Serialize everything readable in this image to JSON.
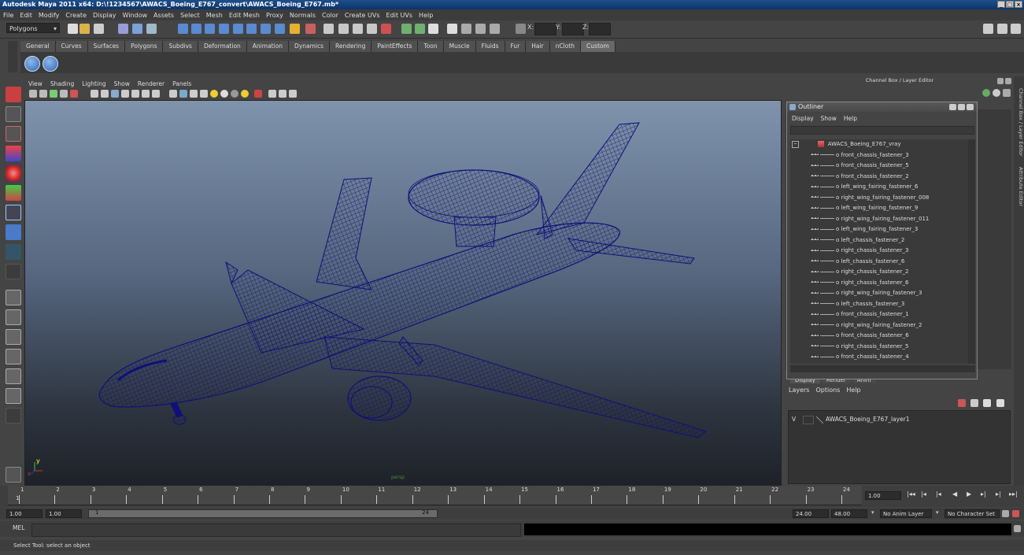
{
  "window": {
    "title": "Autodesk Maya 2011 x64: D:\\!1234567\\AWACS_Boeing_E767_convert\\AWACS_Boeing_E767.mb*",
    "controls": [
      "_",
      "□",
      "×"
    ]
  },
  "menubar": [
    "File",
    "Edit",
    "Modify",
    "Create",
    "Display",
    "Window",
    "Assets",
    "Select",
    "Mesh",
    "Edit Mesh",
    "Proxy",
    "Normals",
    "Color",
    "Create UVs",
    "Edit UVs",
    "Help"
  ],
  "statusline": {
    "mode": "Polygons",
    "x_label": "X:",
    "y_label": "Y:",
    "z_label": "Z:"
  },
  "shelf_tabs": [
    "General",
    "Curves",
    "Surfaces",
    "Polygons",
    "Subdivs",
    "Deformation",
    "Animation",
    "Dynamics",
    "Rendering",
    "PaintEffects",
    "Toon",
    "Muscle",
    "Fluids",
    "Fur",
    "Hair",
    "nCloth",
    "Custom"
  ],
  "shelf_active_tab": "Custom",
  "panel_menu": [
    "View",
    "Shading",
    "Lighting",
    "Show",
    "Renderer",
    "Panels"
  ],
  "viewport": {
    "camera_label": "persp",
    "wire_color": "#10107a",
    "axis_y": "y",
    "axis_x": "x"
  },
  "channel_box": {
    "title": "Channel Box / Layer Editor"
  },
  "side_tabs": [
    "Channel Box / Layer Editor",
    "Attribute Editor"
  ],
  "outliner": {
    "title": "Outliner",
    "menu": [
      "Display",
      "Show",
      "Help"
    ],
    "root": "AWACS_Boeing_E767_vray",
    "items": [
      "front_chassis_fastener_3",
      "front_chassis_fastener_5",
      "front_chassis_fastener_2",
      "left_wing_fairing_fastener_6",
      "right_wing_fairing_fastener_008",
      "left_wing_fairing_fastener_9",
      "right_wing_fairing_fastener_011",
      "left_wing_fairing_fastener_3",
      "left_chassis_fastener_2",
      "right_chassis_fastener_3",
      "left_chassis_fastener_6",
      "right_chassis_fastener_2",
      "right_chassis_fastener_6",
      "right_wing_fairing_fastener_3",
      "left_chassis_fastener_3",
      "front_chassis_fastener_1",
      "right_wing_fairing_fastener_2",
      "front_chassis_fastener_6",
      "right_chassis_fastener_5",
      "front_chassis_fastener_4"
    ]
  },
  "layer_editor": {
    "tabs": [
      "Display",
      "Render",
      "Anim"
    ],
    "menu": [
      "Layers",
      "Options",
      "Help"
    ],
    "layer_visibility": "V",
    "layer_name": "AWACS_Boeing_E767_layer1"
  },
  "timeline": {
    "ticks": [
      "1",
      "2",
      "3",
      "4",
      "5",
      "6",
      "7",
      "8",
      "9",
      "10",
      "11",
      "12",
      "13",
      "14",
      "15",
      "16",
      "17",
      "18",
      "19",
      "20",
      "21",
      "22",
      "23",
      "24"
    ],
    "current_frame": "1.00",
    "current_marker": "1"
  },
  "range": {
    "start_time": "1.00",
    "playback_start": "1.00",
    "slider_start": "1",
    "slider_end": "24",
    "playback_end": "24.00",
    "end_time": "48.00",
    "anim_layer": "No Anim Layer",
    "character_set": "No Character Set"
  },
  "command": {
    "label": "MEL"
  },
  "help_line": "Select Tool: select an object"
}
